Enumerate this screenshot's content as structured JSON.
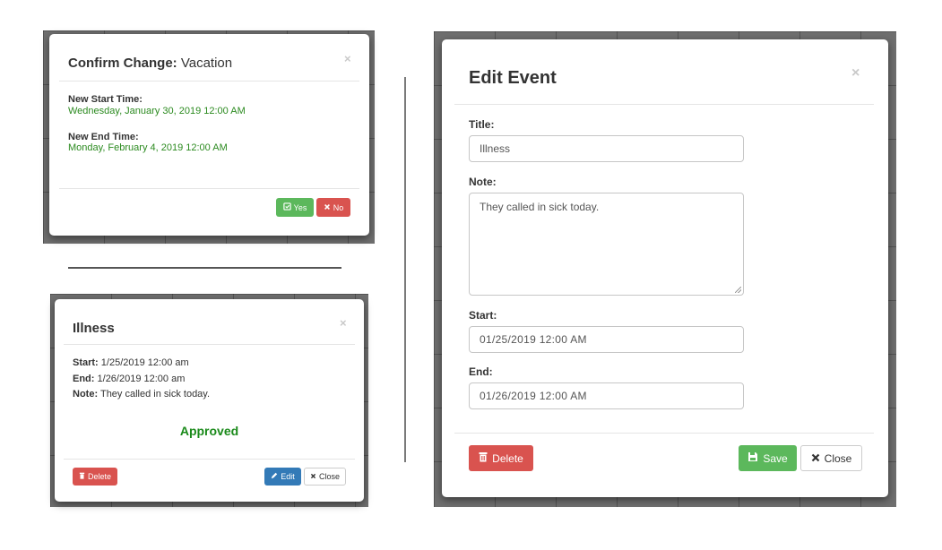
{
  "confirm_modal": {
    "title_prefix": "Confirm Change:",
    "title_name": "Vacation",
    "close_glyph": "×",
    "new_start_label": "New Start Time:",
    "new_start_value": "Wednesday, January 30, 2019 12:00 AM",
    "new_end_label": "New End Time:",
    "new_end_value": "Monday, February 4, 2019 12:00 AM",
    "yes_label": "Yes",
    "no_label": "No",
    "yes_icon": "check-square-icon",
    "no_icon": "times-icon"
  },
  "details_modal": {
    "title": "Illness",
    "close_glyph": "×",
    "start_label": "Start:",
    "start_value": "1/25/2019 12:00 am",
    "end_label": "End:",
    "end_value": "1/26/2019 12:00 am",
    "note_label": "Note:",
    "note_value": "They called in sick today.",
    "status": "Approved",
    "delete_label": "Delete",
    "edit_label": "Edit",
    "close_label": "Close",
    "delete_icon": "trash-icon",
    "edit_icon": "pencil-icon",
    "close_icon": "times-icon"
  },
  "edit_modal": {
    "title": "Edit Event",
    "close_glyph": "×",
    "title_label": "Title:",
    "title_value": "Illness",
    "note_label": "Note:",
    "note_value": "They called in sick today.",
    "start_label": "Start:",
    "start_value": "01/25/2019 12:00 AM",
    "end_label": "End:",
    "end_value": "01/26/2019 12:00 AM",
    "delete_label": "Delete",
    "save_label": "Save",
    "close_label": "Close",
    "delete_icon": "trash-icon",
    "save_icon": "save-icon",
    "close_icon": "times-icon"
  },
  "colors": {
    "success_text": "#2b8a1f",
    "approved_text": "#1a8a1a",
    "success_button": "#5cb85c",
    "danger_button": "#d9534f",
    "primary_button": "#337ab7"
  }
}
